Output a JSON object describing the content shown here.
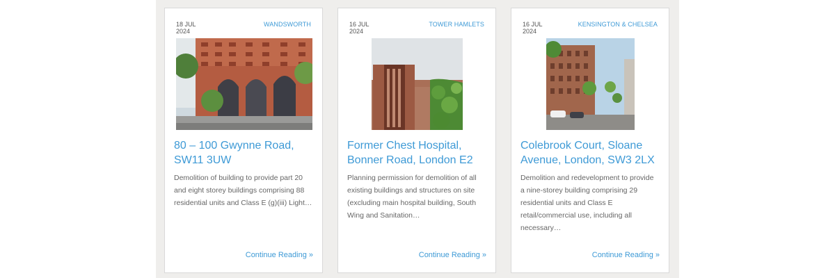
{
  "cards": [
    {
      "date_day": "18 JUL",
      "date_year": "2024",
      "borough": "WANDSWORTH",
      "image_alt": "Red brick apartment block with arched ground floor and trees",
      "title": "80 – 100 Gwynne Road, SW11 3UW",
      "excerpt": "Demolition of building to provide part 20 and eight storey buildings comprising 88 residential units and Class E (g)(iii) Light…",
      "link": "Continue Reading »"
    },
    {
      "date_day": "16 JUL",
      "date_year": "2024",
      "borough": "TOWER HAMLETS",
      "image_alt": "Brick tower building beside a green landscaped walkway",
      "title": "Former Chest Hospital, Bonner Road, London E2",
      "excerpt": "Planning permission for demolition of all existing buildings and structures on site (excluding main hospital building, South Wing and Sanitation…",
      "link": "Continue Reading »"
    },
    {
      "date_day": "16 JUL",
      "date_year": "2024",
      "borough": "KENSINGTON & CHELSEA",
      "image_alt": "Street view of a nine-storey brick building with trees and parked cars",
      "title": "Colebrook Court, Sloane Avenue, London, SW3 2LX",
      "excerpt": "Demolition and redevelopment to provide a nine-storey building comprising 29 residential units and Class E retail/commercial use, including all necessary…",
      "link": "Continue Reading »"
    }
  ],
  "colors": {
    "accent": "#3e9ad6",
    "text": "#666666",
    "band": "#efeeec",
    "border": "#d9d9d9"
  }
}
